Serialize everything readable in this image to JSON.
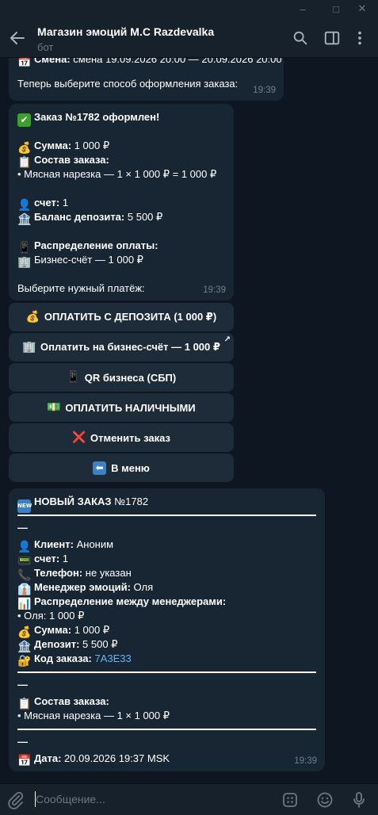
{
  "window": {
    "minimize": "–",
    "maximize": "□",
    "close": "✕"
  },
  "header": {
    "title": "Магазин эмоций M.C Razdevalka",
    "subtitle": "бот"
  },
  "msg1": {
    "shift_label": "Смена:",
    "shift_value": "смена 19.09.2026 20:00 — 20.09.2026 20:00",
    "prompt": "Теперь выберите способ оформления заказа:",
    "time": "19:39"
  },
  "msg2": {
    "heading": "Заказ №1782 оформлен!",
    "sum_label": "Сумма:",
    "sum_value": "1 000 ₽",
    "items_label": "Состав заказа:",
    "item_line": "• Мясная нарезка — 1 × 1 000 ₽ = 1 000 ₽",
    "account_label": "счет:",
    "account_value": "1",
    "deposit_label": "Баланс депозита:",
    "deposit_value": "5 500 ₽",
    "distribution_label": "Распределение оплаты:",
    "distribution_line": "Бизнес-счёт — 1 000 ₽",
    "choose": "Выберите нужный платёж:",
    "time": "19:39"
  },
  "keyboard": [
    {
      "label": "ОПЛАТИТЬ С ДЕПОЗИТА (1 000 ₽)",
      "icon": "money-bag-icon",
      "glyph": "💰"
    },
    {
      "label": "Оплатить на бизнес-счёт — 1 000 ₽",
      "icon": "office-building-icon",
      "glyph": "🏢"
    },
    {
      "label": "QR бизнеса (СБП)",
      "icon": "mobile-phone-icon",
      "glyph": "📱"
    },
    {
      "label": "ОПЛАТИТЬ НАЛИЧНЫМИ",
      "icon": "banknote-icon",
      "glyph": "💵"
    },
    {
      "label": "Отменить заказ",
      "icon": "cross-mark-icon",
      "glyph": "❌"
    },
    {
      "label": "В меню",
      "icon": "back-arrow-icon",
      "glyph": "⬅"
    }
  ],
  "msg3": {
    "heading_prefix": "НОВЫЙ ЗАКАЗ",
    "heading_number": "№1782",
    "dash": "—",
    "client_label": "Клиент:",
    "client_value": "Аноним",
    "account_label": "счет:",
    "account_value": "1",
    "phone_label": "Телефон:",
    "phone_value": "не указан",
    "manager_label": "Менеджер эмоций:",
    "manager_value": "Оля",
    "split_label": "Распределение между менеджерами:",
    "split_line": "• Оля: 1 000 ₽",
    "sum_label": "Сумма:",
    "sum_value": "1 000 ₽",
    "deposit_label": "Депозит:",
    "deposit_value": "5 500 ₽",
    "code_label": "Код заказа:",
    "code_value": "7A3E33",
    "items_label": "Состав заказа:",
    "item_line": "• Мясная нарезка — 1 × 1 000 ₽",
    "date_label": "Дата:",
    "date_value": "20.09.2026 19:37 MSK",
    "time": "19:39"
  },
  "composer": {
    "placeholder": "Сообщение..."
  },
  "colors": {
    "background": "#0e1621",
    "header": "#17212b",
    "bubble": "#182533",
    "button": "#1e2c3a",
    "link": "#6ab3f3"
  }
}
